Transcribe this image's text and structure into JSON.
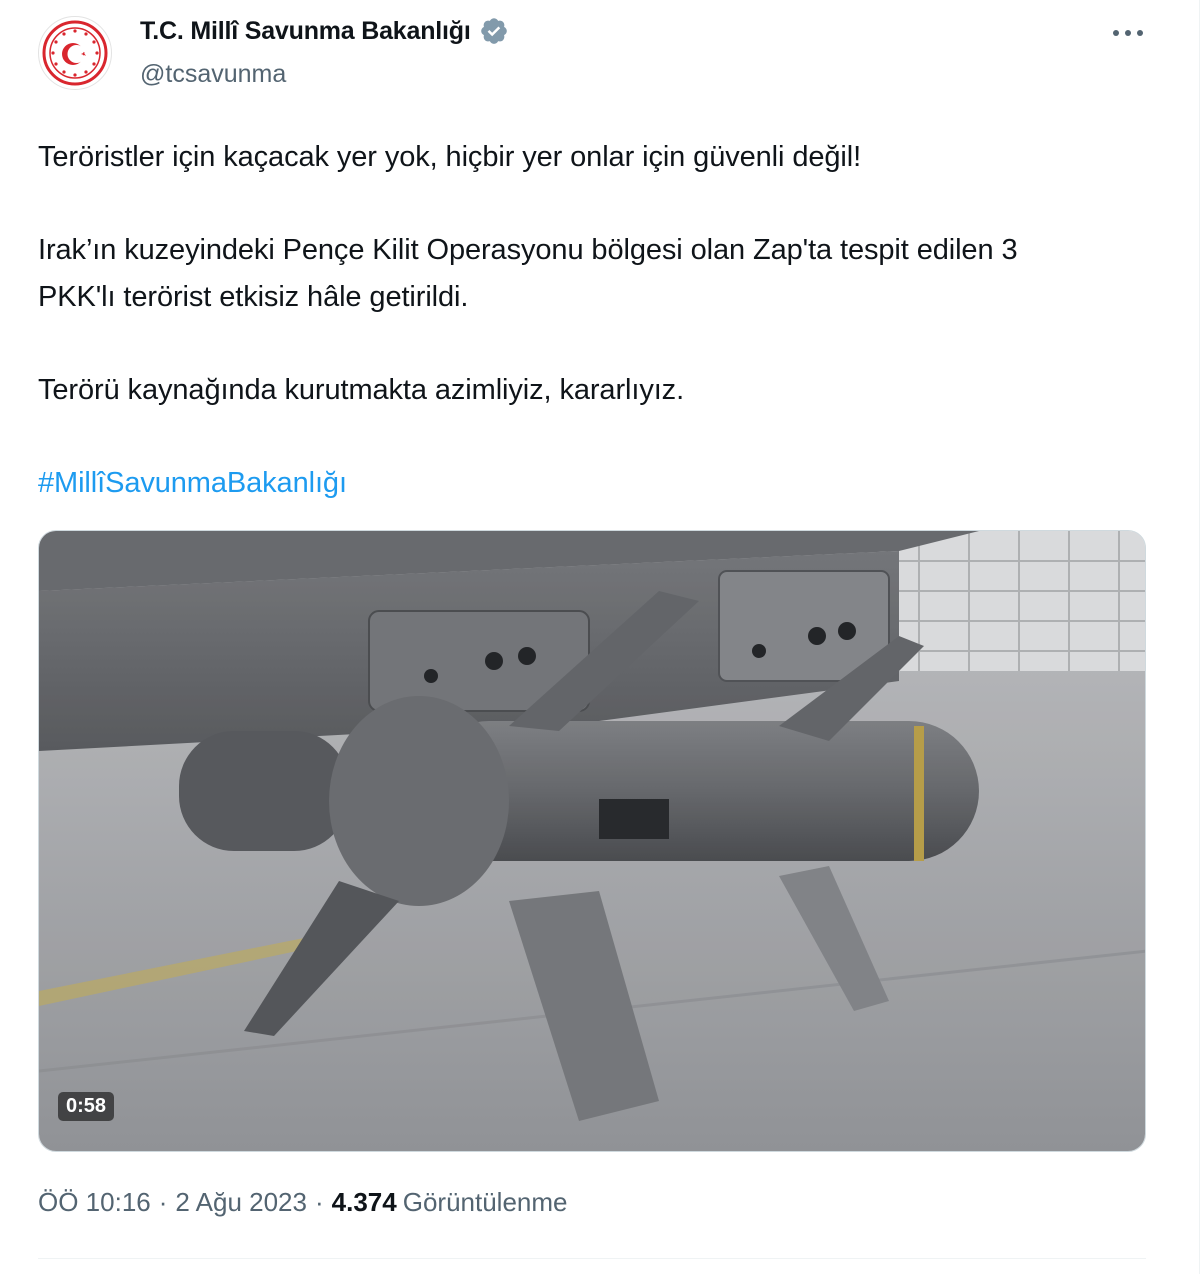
{
  "author": {
    "display_name": "T.C. Millî Savunma Bakanlığı",
    "handle": "@tcsavunma",
    "avatar_icon": "ministry-emblem-icon",
    "verified_icon": "verified-badge-icon",
    "verified_color": "#829aab"
  },
  "more_icon": "more-options-icon",
  "tweet": {
    "line1": "Teröristler için kaçacak yer yok, hiçbir yer onlar için güvenli değil!",
    "line2": "Irak’ın kuzeyindeki Pençe Kilit Operasyonu bölgesi olan Zap'ta tespit edilen 3 PKK'lı terörist etkisiz hâle getirildi.",
    "line3": "Terörü kaynağında kurutmakta azimliyiz, kararlıyız.",
    "hashtag": "#MillîSavunmaBakanlığı"
  },
  "media": {
    "type": "video",
    "duration": "0:58"
  },
  "meta": {
    "time": "ÖÖ 10:16",
    "date": "2 Ağu 2023",
    "separator": "·",
    "views_count": "4.374",
    "views_label": "Görüntülenme"
  },
  "colors": {
    "accent": "#1d9bf0",
    "emblem_red": "#d9262e",
    "secondary_text": "#536471"
  }
}
